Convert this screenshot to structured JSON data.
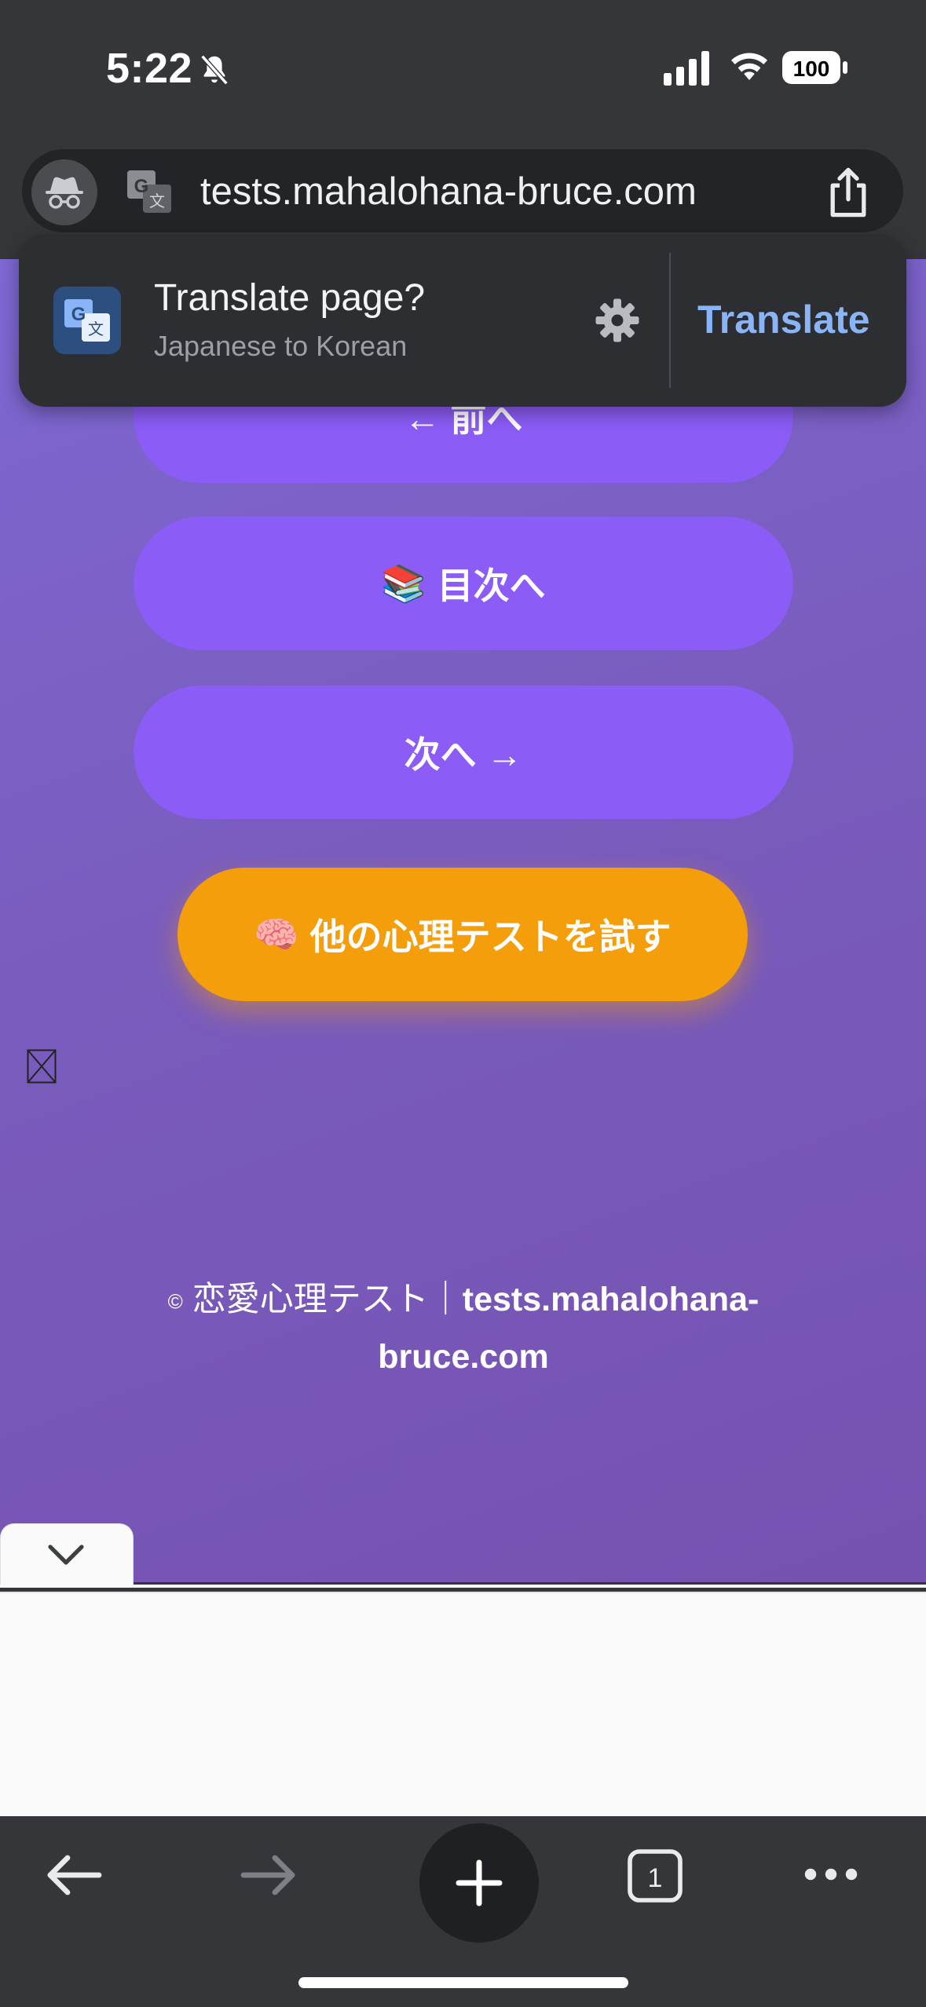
{
  "status_bar": {
    "time": "5:22",
    "battery": "100"
  },
  "browser": {
    "url": "tests.mahalohana-bruce.com"
  },
  "translate_banner": {
    "title": "Translate page?",
    "subtitle": "Japanese to Korean",
    "action": "Translate"
  },
  "page": {
    "prev_button": "← 前へ",
    "toc_button": {
      "emoji": "📚",
      "label": "目次へ"
    },
    "next_button": "次へ →",
    "other_tests_button": {
      "emoji": "🧠",
      "label": "他の心理テストを試す"
    },
    "broken_image_glyph": "⊠",
    "footer": {
      "copyright": "©",
      "text": "恋愛心理テスト｜",
      "domain": "tests.mahalohana-bruce.com",
      "domain_line1": "tests.mahalohana-",
      "domain_line2": "bruce.com"
    }
  },
  "toolbar": {
    "tab_count": "1"
  },
  "colors": {
    "chrome": "#34363a",
    "purple_button": "#8b5cf6",
    "orange_button": "#f59e0b",
    "translate_blue": "#8ab4f8"
  }
}
